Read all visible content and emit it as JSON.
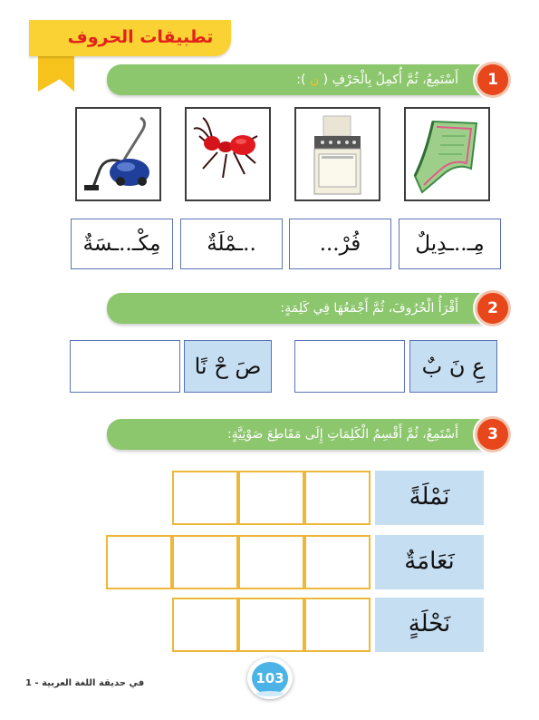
{
  "header": {
    "title": "تطبيقات الحروف"
  },
  "exercise1": {
    "number": "1",
    "instruction_main": "أَسْتَمِعُ، ثُمَّ أُكمِلُ بِالْحَرْفِ ( ",
    "instruction_letter": "ن",
    "instruction_end": " ):",
    "images": [
      "towel-image",
      "stove-image",
      "ant-image",
      "vacuum-cleaner-image"
    ],
    "words": [
      "مِـ..ـدِيلٌ",
      "فُرْ...",
      "..ـمْلَةٌ",
      "مِكْـ..ـسَةٌ"
    ]
  },
  "exercise2": {
    "number": "2",
    "instruction": "أَقْرَأُ الْحُرُوفَ، ثُمَّ أَجْمَعُهَا فِي كَلِمَةٍ:",
    "groups": [
      {
        "letters": "عِ نَ بٌ"
      },
      {
        "letters": "صَ حْ نًا"
      }
    ]
  },
  "exercise3": {
    "number": "3",
    "instruction": "أَسْتَمِعُ، ثُمَّ أَقْسِمُ الْكَلِمَاتِ إِلَى مَقَاطِعَ صَوْتِيَّةٍ:",
    "words": [
      "نَمْلَةً",
      "نَعَامَةٌ",
      "نَحْلَةٍ"
    ],
    "cells_per_row": [
      3,
      4,
      3
    ]
  },
  "footer": {
    "page_number": "103",
    "book_title": "في حديقة اللغة العربية - 1"
  }
}
